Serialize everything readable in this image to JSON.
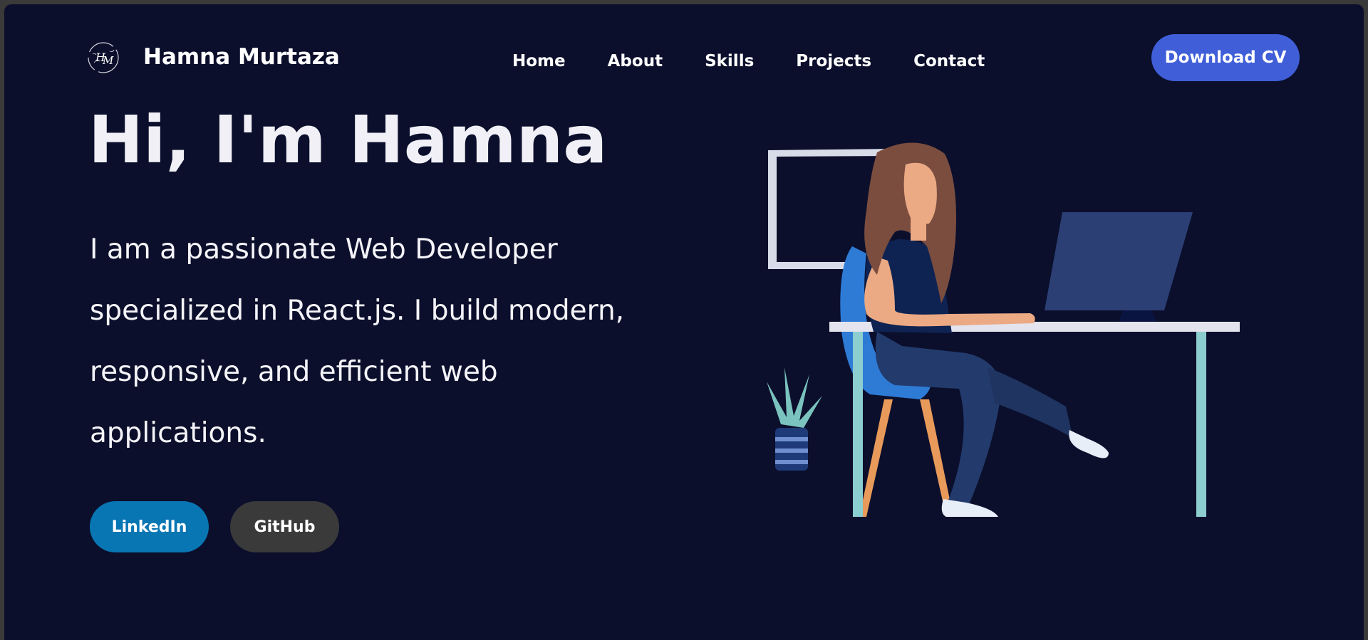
{
  "header": {
    "logo_icon": "hm-monogram-logo",
    "brand_name": "Hamna Murtaza",
    "nav": [
      {
        "label": "Home"
      },
      {
        "label": "About"
      },
      {
        "label": "Skills"
      },
      {
        "label": "Projects"
      },
      {
        "label": "Contact"
      }
    ],
    "cv_button": "Download CV"
  },
  "hero": {
    "title": "Hi, I'm Hamna",
    "description_lines": [
      "I am a passionate Web Developer",
      "specialized in React.js. I build modern,",
      "responsive, and efficient web",
      "applications."
    ],
    "buttons": {
      "linkedin": "LinkedIn",
      "github": "GitHub"
    },
    "illustration_icon": "woman-working-at-desk-illustration"
  },
  "colors": {
    "background": "#0b0f2c",
    "accent": "#3f5ed8",
    "linkedin": "#0976b4",
    "github": "#3a3a3a"
  }
}
